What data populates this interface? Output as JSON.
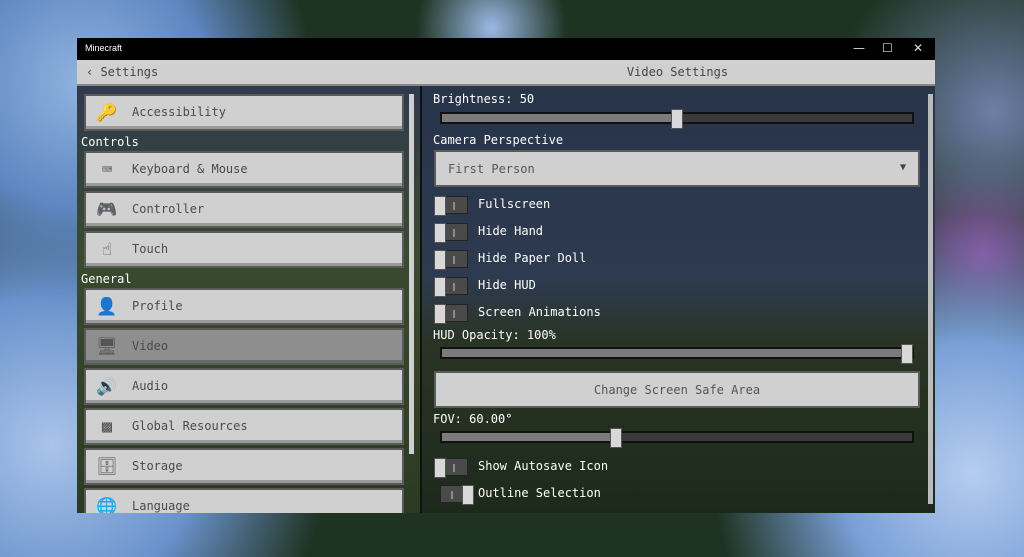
{
  "window": {
    "title": "Minecraft",
    "minimize": "—",
    "maximize": "☐",
    "close": "✕"
  },
  "header": {
    "back": "‹ Settings",
    "title": "Video Settings"
  },
  "sidebar": {
    "sections": [
      "Controls",
      "General"
    ],
    "items": [
      {
        "label": "Accessibility",
        "icon": "key-icon",
        "glyph": "🔑"
      },
      {
        "label": "Keyboard & Mouse",
        "icon": "keyboard-icon",
        "glyph": "⌨"
      },
      {
        "label": "Controller",
        "icon": "controller-icon",
        "glyph": "🎮"
      },
      {
        "label": "Touch",
        "icon": "touch-icon",
        "glyph": "☝"
      },
      {
        "label": "Profile",
        "icon": "profile-icon",
        "glyph": "👤"
      },
      {
        "label": "Video",
        "icon": "monitor-icon",
        "glyph": "🖥",
        "selected": true
      },
      {
        "label": "Audio",
        "icon": "speaker-icon",
        "glyph": "🔊"
      },
      {
        "label": "Global Resources",
        "icon": "grass-block-icon",
        "glyph": "▩"
      },
      {
        "label": "Storage",
        "icon": "storage-icon",
        "glyph": "🗄"
      },
      {
        "label": "Language",
        "icon": "language-icon",
        "glyph": "🌐"
      }
    ]
  },
  "video": {
    "brightness": {
      "label": "Brightness: 50",
      "value": 50
    },
    "camera": {
      "label": "Camera Perspective",
      "value": "First Person"
    },
    "toggles": [
      {
        "label": "Fullscreen",
        "on": false
      },
      {
        "label": "Hide Hand",
        "on": false
      },
      {
        "label": "Hide Paper Doll",
        "on": false
      },
      {
        "label": "Hide HUD",
        "on": false
      },
      {
        "label": "Screen Animations",
        "on": false
      }
    ],
    "hud_opacity": {
      "label": "HUD Opacity: 100%",
      "value": 100
    },
    "safe_area_button": "Change Screen Safe Area",
    "fov": {
      "label": "FOV: 60.00°",
      "fraction": 0.37
    },
    "toggles2": [
      {
        "label": "Show Autosave Icon",
        "on": false
      },
      {
        "label": "Outline Selection",
        "on": true
      }
    ]
  }
}
